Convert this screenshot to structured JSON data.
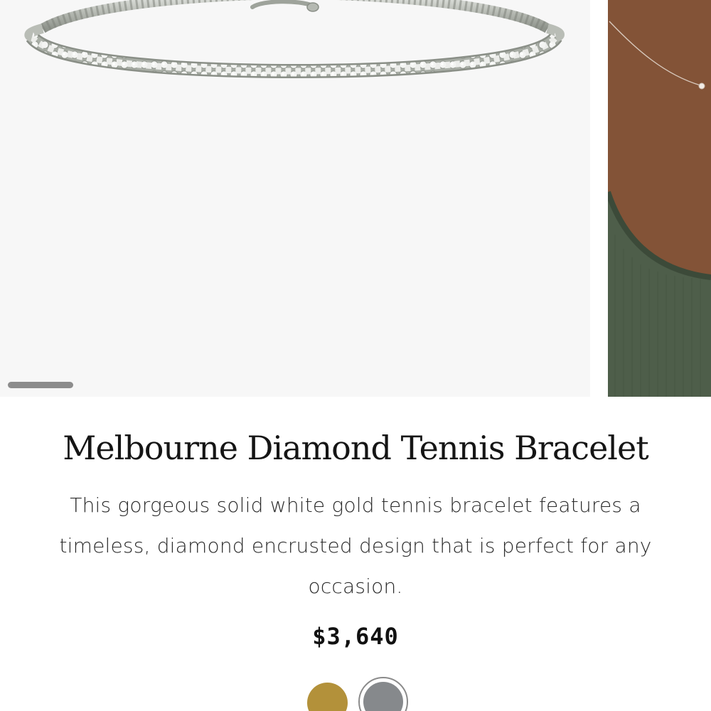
{
  "product": {
    "title": "Melbourne Diamond Tennis Bracelet",
    "description": "This gorgeous solid white gold tennis bracelet features a timeless, diamond encrusted design that is perfect for any occasion.",
    "price": "$3,640"
  },
  "gallery": {
    "slides": [
      "bracelet-product-photo",
      "necklace-model-photo"
    ],
    "active_index": 0
  },
  "swatches": [
    {
      "name": "gold",
      "color": "#b3913a",
      "selected": false
    },
    {
      "name": "white-gold",
      "color": "#86898c",
      "selected": true
    }
  ],
  "colors": {
    "image_background": "#f7f7f7",
    "scroll_indicator": "#8d8d8d",
    "skin_tone": "#8a5a3c",
    "garment_green": "#4e5e4a"
  }
}
